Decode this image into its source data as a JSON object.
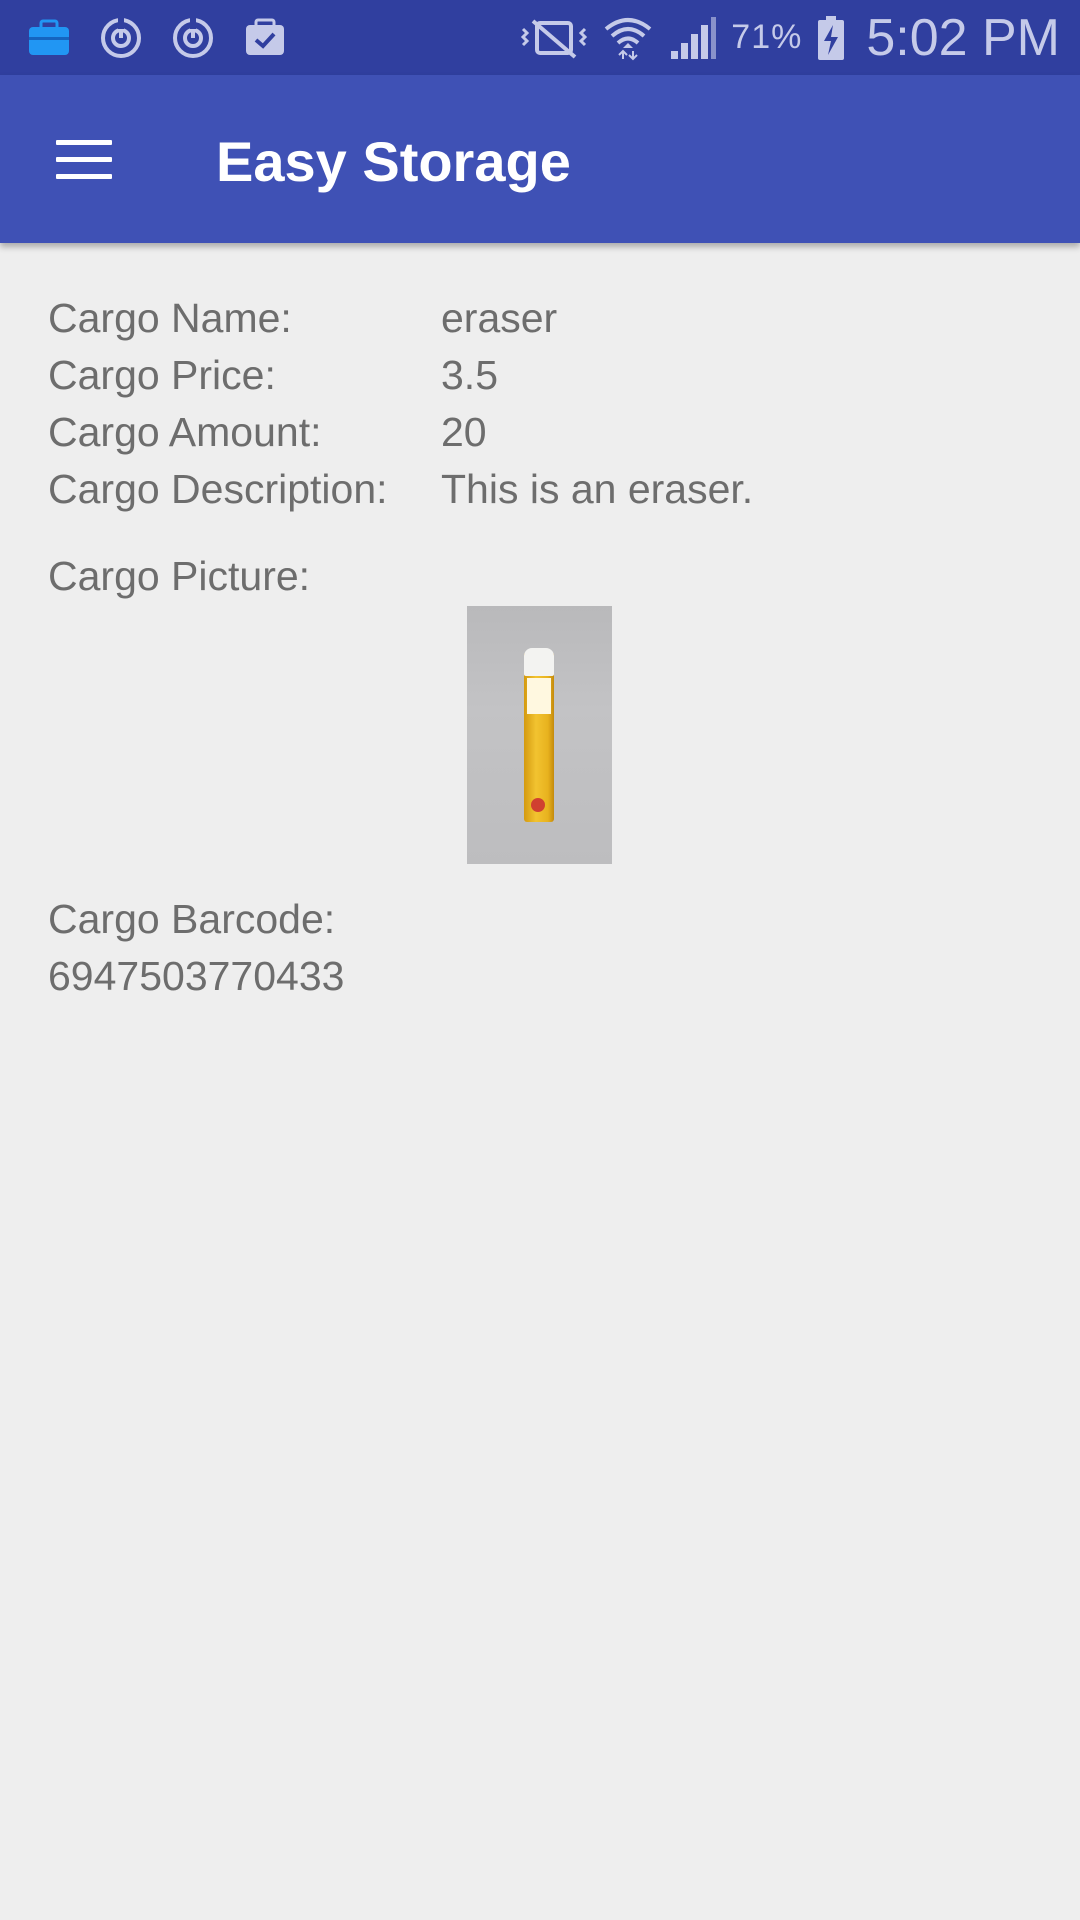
{
  "status_bar": {
    "left_icons": [
      "briefcase-icon",
      "sync-icon",
      "sync-icon",
      "clipboard-check-icon"
    ],
    "right_icons": [
      "vibrate-mute-icon",
      "wifi-icon",
      "signal-icon",
      "battery-charging-icon"
    ],
    "battery_percent": "71%",
    "time": "5:02 PM",
    "colors": {
      "background": "#303f9f",
      "icons": "#c5cae9"
    }
  },
  "app_bar": {
    "title": "Easy Storage",
    "menu_icon": "hamburger-menu-icon",
    "colors": {
      "background": "#3f51b5",
      "title": "#ffffff"
    }
  },
  "cargo": {
    "name_label": "Cargo Name:",
    "name_value": "eraser",
    "price_label": "Cargo Price:",
    "price_value": "3.5",
    "amount_label": "Cargo Amount:",
    "amount_value": "20",
    "description_label": "Cargo Description:",
    "description_value": "This is an eraser.",
    "picture_label": "Cargo Picture:",
    "barcode_label": "Cargo Barcode:",
    "barcode_value": "6947503770433"
  },
  "colors": {
    "page_background": "#eeeeee",
    "text": "#6d6d6d"
  }
}
